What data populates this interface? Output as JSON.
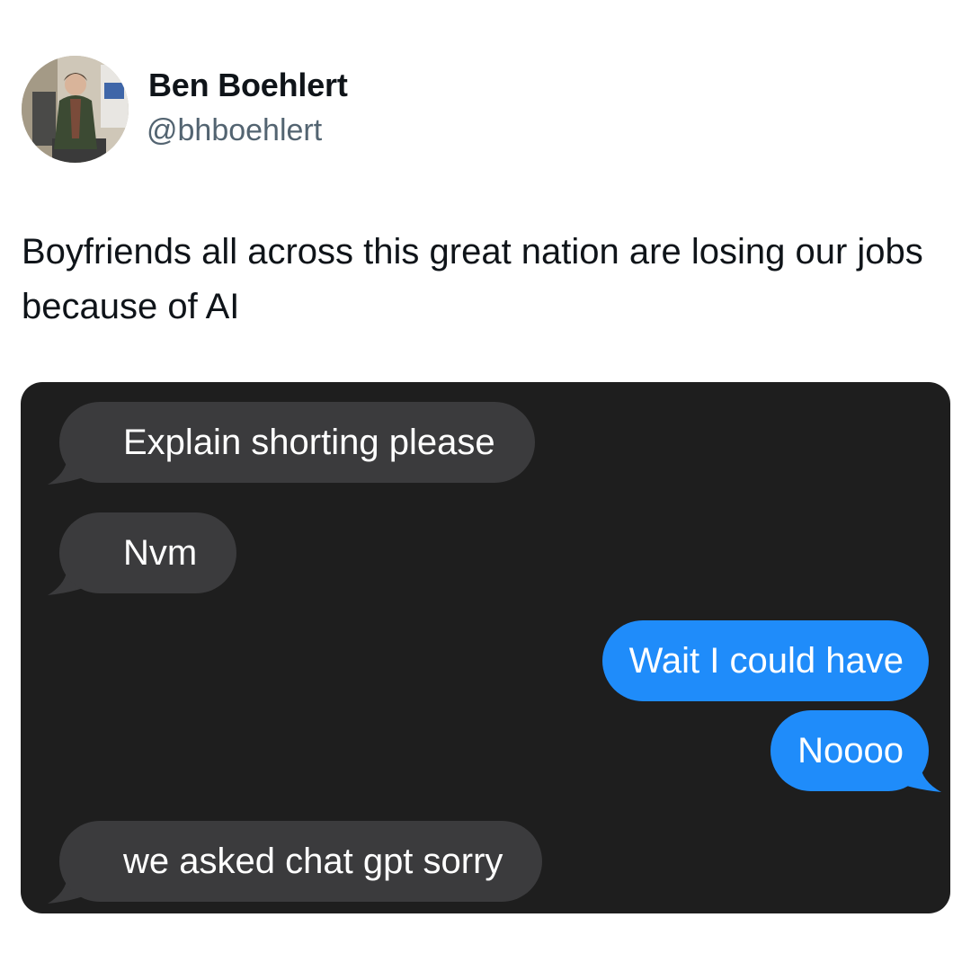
{
  "tweet": {
    "author_name": "Ben Boehlert",
    "author_handle": "@bhboehlert",
    "text": "Boyfriends all across this great nation are losing our jobs because of AI"
  },
  "conversation": {
    "messages": [
      {
        "direction": "received",
        "text": "Explain shorting please"
      },
      {
        "direction": "received",
        "text": "Nvm"
      },
      {
        "direction": "sent",
        "text": "Wait I could have"
      },
      {
        "direction": "sent",
        "text": "Noooo"
      },
      {
        "direction": "received",
        "text": "we asked chat gpt sorry"
      }
    ]
  },
  "colors": {
    "chat_background": "#1e1e1e",
    "received_bubble": "#3b3b3d",
    "sent_bubble": "#1f8cfa",
    "handle_gray": "#536471"
  },
  "icons": {
    "avatar": "profile-photo"
  }
}
